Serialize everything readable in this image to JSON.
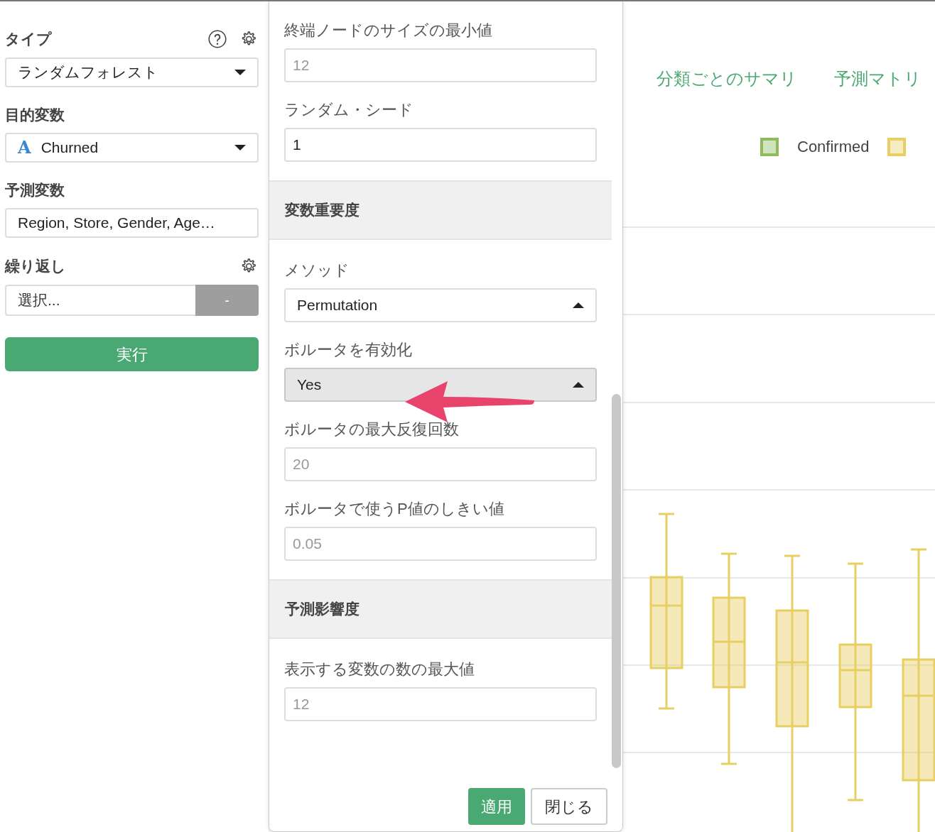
{
  "left_panel": {
    "type_field": {
      "label": "タイプ",
      "value": "ランダムフォレスト"
    },
    "target_field": {
      "label": "目的変数",
      "type_icon": "A",
      "value": "Churned"
    },
    "predictor_field": {
      "label": "予測変数",
      "value": "Region, Store, Gender, Age…"
    },
    "repeat_field": {
      "label": "繰り返し",
      "value": "選択...",
      "button": "-"
    },
    "run_button": "実行"
  },
  "settings_panel": {
    "items": [
      {
        "kind": "input",
        "label": "終端ノードのサイズの最小値",
        "placeholder": "12"
      },
      {
        "kind": "input",
        "label": "ランダム・シード",
        "value": "1"
      },
      {
        "kind": "section",
        "title": "変数重要度"
      },
      {
        "kind": "select",
        "label": "メソッド",
        "value": "Permutation",
        "focused": false
      },
      {
        "kind": "select",
        "label": "ボルータを有効化",
        "value": "Yes",
        "focused": true
      },
      {
        "kind": "input",
        "label": "ボルータの最大反復回数",
        "placeholder": "20"
      },
      {
        "kind": "input",
        "label": "ボルータで使うP値のしきい値",
        "placeholder": "0.05"
      },
      {
        "kind": "section",
        "title": "予測影響度"
      },
      {
        "kind": "input",
        "label": "表示する変数の数の最大値",
        "placeholder": "12"
      }
    ],
    "buttons": [
      {
        "label": "適用",
        "kind": "primary"
      },
      {
        "label": "閉じる",
        "kind": "secondary"
      }
    ]
  },
  "result_area": {
    "tabs": [
      {
        "label": "分類ごとのサマリ"
      },
      {
        "label": "予測マトリ"
      }
    ],
    "legend": [
      {
        "label": "Confirmed",
        "color": "#8fbb5e"
      },
      {
        "color": "#e8cf63"
      }
    ]
  }
}
